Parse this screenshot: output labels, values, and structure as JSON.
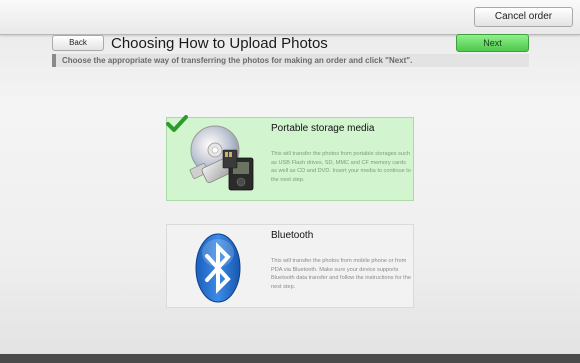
{
  "header": {
    "cancel_label": "Cancel order"
  },
  "nav": {
    "back_label": "Back",
    "next_label": "Next"
  },
  "page": {
    "title": "Choosing How to Upload Photos",
    "subtitle": "Choose the appropriate way of transferring the photos for making an order and click \"Next\"."
  },
  "options": [
    {
      "title": "Portable storage media",
      "description": "This will transfer the photos from portable storages such as USB Flash drives, SD, MMC and CF memory cards as well as CD and DVD. Insert your media to continue to the next step.",
      "selected": true,
      "icon": "storage-media-icon"
    },
    {
      "title": "Bluetooth",
      "description": "This will transfer the photos from mobile phone or from PDA via Bluetooth. Make sure your device supports Bluetooth data transfer and follow the instructions for the next step.",
      "selected": false,
      "icon": "bluetooth-icon"
    }
  ],
  "colors": {
    "next_button": "#5fd35a",
    "selected_option_bg": "#d2f5d0",
    "check": "#2e9a2a",
    "bluetooth_blue": "#1e6fd0"
  }
}
